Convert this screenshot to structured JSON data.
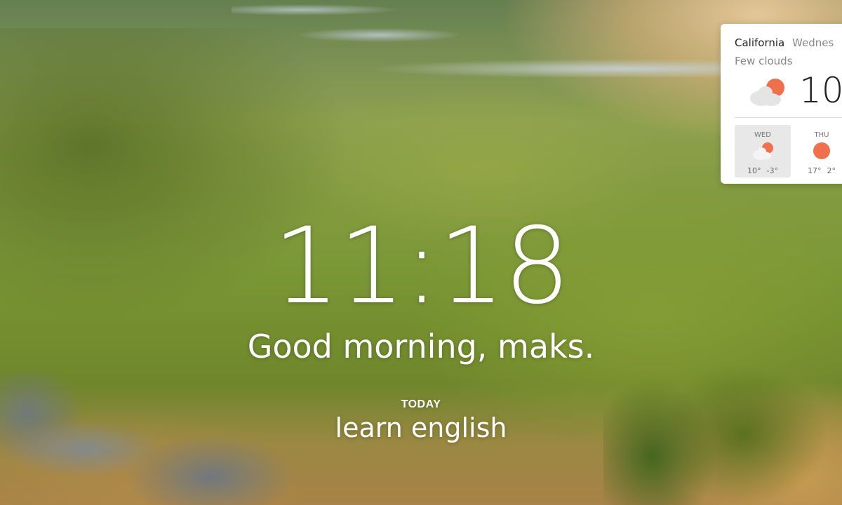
{
  "clock": {
    "time": "11:18"
  },
  "greeting": {
    "text": "Good morning, maks."
  },
  "focus": {
    "label": "TODAY",
    "text": "learn english"
  },
  "weather": {
    "location": "California",
    "day": "Wednes",
    "condition": "Few clouds",
    "temperature": "10",
    "icon": "partly-cloudy-icon",
    "forecast": [
      {
        "day": "WED",
        "icon": "partly-cloudy-icon",
        "high": "10°",
        "low": "-3°",
        "active": true
      },
      {
        "day": "THU",
        "icon": "sun-icon",
        "high": "17°",
        "low": "2°",
        "active": false
      }
    ]
  },
  "colors": {
    "sun": "#f0704e",
    "cloud": "#e4e4e4",
    "card": "#ffffff"
  }
}
